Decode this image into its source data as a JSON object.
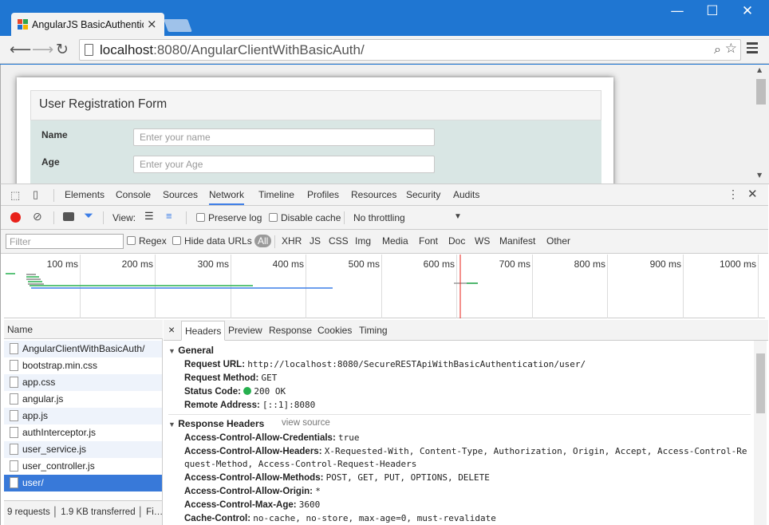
{
  "browser": {
    "tab_title": "AngularJS BasicAuthentic",
    "tab_close": "×",
    "window_controls": {
      "minimize": "—",
      "maximize": "☐",
      "close": "✕"
    },
    "url_host": "localhost",
    "url_rest": ":8080/AngularClientWithBasicAuth/",
    "icons": [
      "back-icon",
      "forward-icon",
      "reload-icon",
      "page-icon",
      "zoom-icon",
      "star-icon",
      "menu-icon"
    ]
  },
  "page": {
    "form_title": "User Registration Form",
    "fields": [
      {
        "label": "Name",
        "placeholder": "Enter your name"
      },
      {
        "label": "Age",
        "placeholder": "Enter your Age"
      }
    ]
  },
  "devtools": {
    "tabs": [
      "Elements",
      "Console",
      "Sources",
      "Network",
      "Timeline",
      "Profiles",
      "Resources",
      "Security",
      "Audits"
    ],
    "active_tab": "Network",
    "view_label": "View:",
    "preserve_log": "Preserve log",
    "disable_cache": "Disable cache",
    "throttling": "No throttling",
    "filter_placeholder": "Filter",
    "regex": "Regex",
    "hide_data_urls": "Hide data URLs",
    "all": "All",
    "types": [
      "XHR",
      "JS",
      "CSS",
      "Img",
      "Media",
      "Font",
      "Doc",
      "WS",
      "Manifest",
      "Other"
    ],
    "timeline_ticks": [
      "100 ms",
      "200 ms",
      "300 ms",
      "400 ms",
      "500 ms",
      "600 ms",
      "700 ms",
      "800 ms",
      "900 ms",
      "1000 ms"
    ],
    "requests_header": "Name",
    "requests": [
      "AngularClientWithBasicAuth/",
      "bootstrap.min.css",
      "app.css",
      "angular.js",
      "app.js",
      "authInterceptor.js",
      "user_service.js",
      "user_controller.js",
      "user/"
    ],
    "selected_request": "user/",
    "footer": "9 requests │ 1.9 KB transferred │ Fi…",
    "detail_close": "×",
    "detail_tabs": [
      "Headers",
      "Preview",
      "Response",
      "Cookies",
      "Timing"
    ],
    "active_detail_tab": "Headers",
    "general": {
      "title": "General",
      "items": [
        {
          "k": "Request URL:",
          "v": "http://localhost:8080/SecureRESTApiWithBasicAuthentication/user/"
        },
        {
          "k": "Request Method:",
          "v": "GET"
        },
        {
          "k": "Status Code:",
          "v": "200 OK"
        },
        {
          "k": "Remote Address:",
          "v": "[::1]:8080"
        }
      ]
    },
    "response_headers": {
      "title": "Response Headers",
      "view_source": "view source",
      "items": [
        {
          "k": "Access-Control-Allow-Credentials:",
          "v": "true"
        },
        {
          "k": "Access-Control-Allow-Headers:",
          "v": "X-Requested-With, Content-Type, Authorization, Origin, Accept, Access-Control-Re"
        },
        {
          "k": "",
          "v": "quest-Method, Access-Control-Request-Headers"
        },
        {
          "k": "Access-Control-Allow-Methods:",
          "v": "POST, GET, PUT, OPTIONS, DELETE"
        },
        {
          "k": "Access-Control-Allow-Origin:",
          "v": "*"
        },
        {
          "k": "Access-Control-Max-Age:",
          "v": "3600"
        },
        {
          "k": "Cache-Control:",
          "v": "no-cache, no-store, max-age=0, must-revalidate"
        }
      ]
    },
    "colors": {
      "accent": "#3879d9",
      "status_ok": "#27b04f",
      "record": "#e8211a"
    }
  }
}
